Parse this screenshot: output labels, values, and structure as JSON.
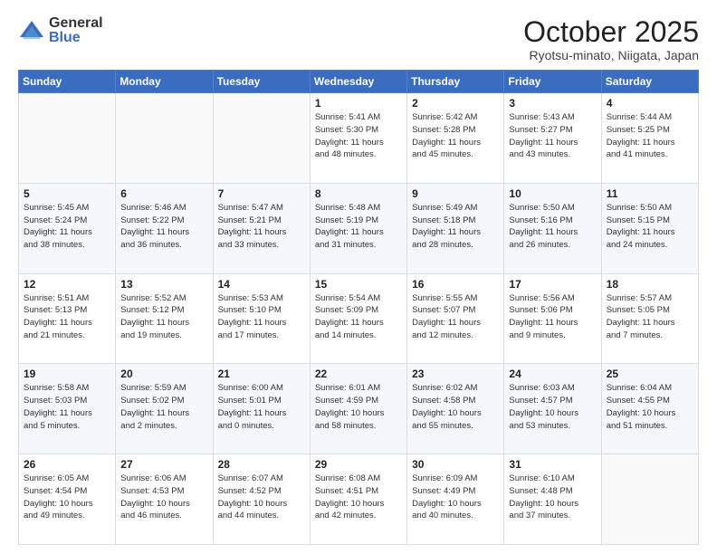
{
  "logo": {
    "general": "General",
    "blue": "Blue"
  },
  "title": "October 2025",
  "location": "Ryotsu-minato, Niigata, Japan",
  "days_of_week": [
    "Sunday",
    "Monday",
    "Tuesday",
    "Wednesday",
    "Thursday",
    "Friday",
    "Saturday"
  ],
  "weeks": [
    [
      {
        "day": "",
        "info": ""
      },
      {
        "day": "",
        "info": ""
      },
      {
        "day": "",
        "info": ""
      },
      {
        "day": "1",
        "info": "Sunrise: 5:41 AM\nSunset: 5:30 PM\nDaylight: 11 hours\nand 48 minutes."
      },
      {
        "day": "2",
        "info": "Sunrise: 5:42 AM\nSunset: 5:28 PM\nDaylight: 11 hours\nand 45 minutes."
      },
      {
        "day": "3",
        "info": "Sunrise: 5:43 AM\nSunset: 5:27 PM\nDaylight: 11 hours\nand 43 minutes."
      },
      {
        "day": "4",
        "info": "Sunrise: 5:44 AM\nSunset: 5:25 PM\nDaylight: 11 hours\nand 41 minutes."
      }
    ],
    [
      {
        "day": "5",
        "info": "Sunrise: 5:45 AM\nSunset: 5:24 PM\nDaylight: 11 hours\nand 38 minutes."
      },
      {
        "day": "6",
        "info": "Sunrise: 5:46 AM\nSunset: 5:22 PM\nDaylight: 11 hours\nand 36 minutes."
      },
      {
        "day": "7",
        "info": "Sunrise: 5:47 AM\nSunset: 5:21 PM\nDaylight: 11 hours\nand 33 minutes."
      },
      {
        "day": "8",
        "info": "Sunrise: 5:48 AM\nSunset: 5:19 PM\nDaylight: 11 hours\nand 31 minutes."
      },
      {
        "day": "9",
        "info": "Sunrise: 5:49 AM\nSunset: 5:18 PM\nDaylight: 11 hours\nand 28 minutes."
      },
      {
        "day": "10",
        "info": "Sunrise: 5:50 AM\nSunset: 5:16 PM\nDaylight: 11 hours\nand 26 minutes."
      },
      {
        "day": "11",
        "info": "Sunrise: 5:50 AM\nSunset: 5:15 PM\nDaylight: 11 hours\nand 24 minutes."
      }
    ],
    [
      {
        "day": "12",
        "info": "Sunrise: 5:51 AM\nSunset: 5:13 PM\nDaylight: 11 hours\nand 21 minutes."
      },
      {
        "day": "13",
        "info": "Sunrise: 5:52 AM\nSunset: 5:12 PM\nDaylight: 11 hours\nand 19 minutes."
      },
      {
        "day": "14",
        "info": "Sunrise: 5:53 AM\nSunset: 5:10 PM\nDaylight: 11 hours\nand 17 minutes."
      },
      {
        "day": "15",
        "info": "Sunrise: 5:54 AM\nSunset: 5:09 PM\nDaylight: 11 hours\nand 14 minutes."
      },
      {
        "day": "16",
        "info": "Sunrise: 5:55 AM\nSunset: 5:07 PM\nDaylight: 11 hours\nand 12 minutes."
      },
      {
        "day": "17",
        "info": "Sunrise: 5:56 AM\nSunset: 5:06 PM\nDaylight: 11 hours\nand 9 minutes."
      },
      {
        "day": "18",
        "info": "Sunrise: 5:57 AM\nSunset: 5:05 PM\nDaylight: 11 hours\nand 7 minutes."
      }
    ],
    [
      {
        "day": "19",
        "info": "Sunrise: 5:58 AM\nSunset: 5:03 PM\nDaylight: 11 hours\nand 5 minutes."
      },
      {
        "day": "20",
        "info": "Sunrise: 5:59 AM\nSunset: 5:02 PM\nDaylight: 11 hours\nand 2 minutes."
      },
      {
        "day": "21",
        "info": "Sunrise: 6:00 AM\nSunset: 5:01 PM\nDaylight: 11 hours\nand 0 minutes."
      },
      {
        "day": "22",
        "info": "Sunrise: 6:01 AM\nSunset: 4:59 PM\nDaylight: 10 hours\nand 58 minutes."
      },
      {
        "day": "23",
        "info": "Sunrise: 6:02 AM\nSunset: 4:58 PM\nDaylight: 10 hours\nand 55 minutes."
      },
      {
        "day": "24",
        "info": "Sunrise: 6:03 AM\nSunset: 4:57 PM\nDaylight: 10 hours\nand 53 minutes."
      },
      {
        "day": "25",
        "info": "Sunrise: 6:04 AM\nSunset: 4:55 PM\nDaylight: 10 hours\nand 51 minutes."
      }
    ],
    [
      {
        "day": "26",
        "info": "Sunrise: 6:05 AM\nSunset: 4:54 PM\nDaylight: 10 hours\nand 49 minutes."
      },
      {
        "day": "27",
        "info": "Sunrise: 6:06 AM\nSunset: 4:53 PM\nDaylight: 10 hours\nand 46 minutes."
      },
      {
        "day": "28",
        "info": "Sunrise: 6:07 AM\nSunset: 4:52 PM\nDaylight: 10 hours\nand 44 minutes."
      },
      {
        "day": "29",
        "info": "Sunrise: 6:08 AM\nSunset: 4:51 PM\nDaylight: 10 hours\nand 42 minutes."
      },
      {
        "day": "30",
        "info": "Sunrise: 6:09 AM\nSunset: 4:49 PM\nDaylight: 10 hours\nand 40 minutes."
      },
      {
        "day": "31",
        "info": "Sunrise: 6:10 AM\nSunset: 4:48 PM\nDaylight: 10 hours\nand 37 minutes."
      },
      {
        "day": "",
        "info": ""
      }
    ]
  ]
}
